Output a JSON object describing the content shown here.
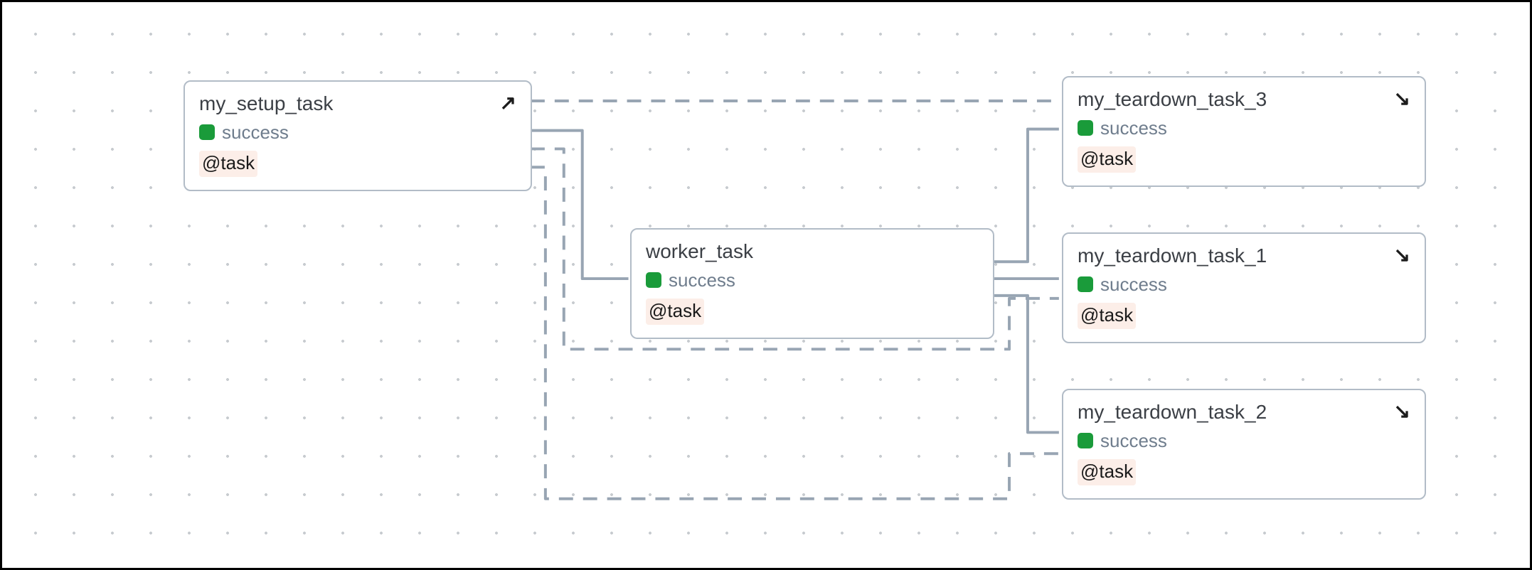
{
  "nodes": {
    "setup": {
      "title": "my_setup_task",
      "status": "success",
      "decorator": "@task",
      "arrow": "↗"
    },
    "worker": {
      "title": "worker_task",
      "status": "success",
      "decorator": "@task"
    },
    "teardown3": {
      "title": "my_teardown_task_3",
      "status": "success",
      "decorator": "@task",
      "arrow": "↘"
    },
    "teardown1": {
      "title": "my_teardown_task_1",
      "status": "success",
      "decorator": "@task",
      "arrow": "↘"
    },
    "teardown2": {
      "title": "my_teardown_task_2",
      "status": "success",
      "decorator": "@task",
      "arrow": "↘"
    }
  },
  "colors": {
    "success": "#1a9b3a",
    "edge": "#98a5b3",
    "nodeBorder": "#b2bcc7",
    "decoratorBg": "#fceee8"
  }
}
